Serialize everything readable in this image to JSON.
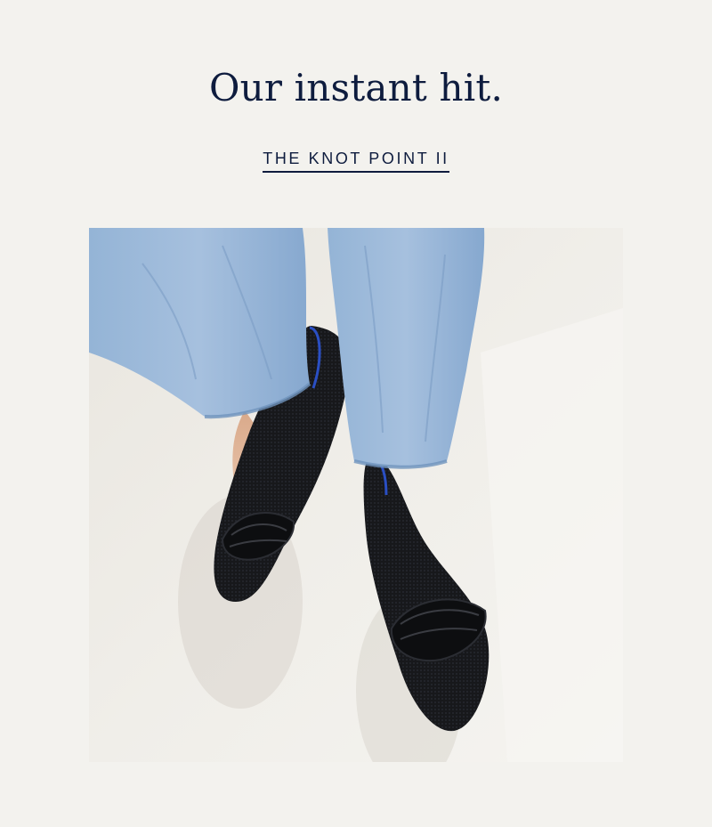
{
  "hero": {
    "headline": "Our instant hit.",
    "cta_label": "THE KNOT POINT II"
  },
  "image": {
    "subject": "shoes-photo",
    "colors": {
      "background": "#f3f2ee",
      "floor": "#eeece6",
      "denim": "#8fb0d4",
      "denim_shadow": "#6f93bd",
      "shoe": "#141517",
      "insole_accent": "#2a4fc4",
      "skin": "#e6bfa3"
    }
  }
}
